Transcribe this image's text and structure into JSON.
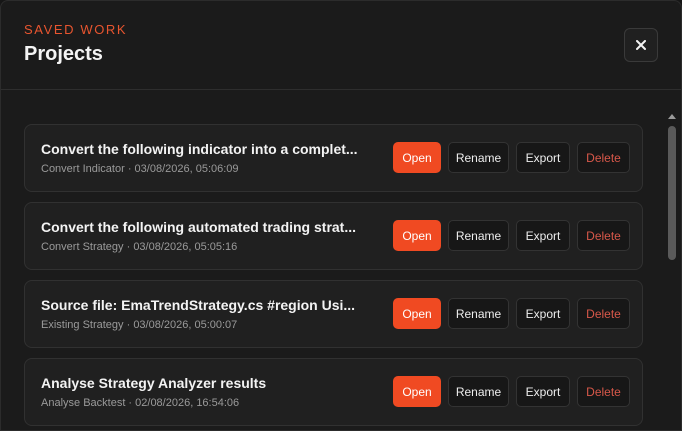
{
  "header": {
    "eyebrow": "SAVED WORK",
    "title": "Projects",
    "close_icon": "close-icon"
  },
  "buttons": {
    "open": "Open",
    "rename": "Rename",
    "export": "Export",
    "delete": "Delete"
  },
  "projects": [
    {
      "title": "Convert the following indicator into a complet...",
      "meta": "Convert Indicator · 03/08/2026, 05:06:09"
    },
    {
      "title": "Convert the following automated trading strat...",
      "meta": "Convert Strategy · 03/08/2026, 05:05:16"
    },
    {
      "title": "Source file: EmaTrendStrategy.cs #region Usi...",
      "meta": "Existing Strategy · 03/08/2026, 05:00:07"
    },
    {
      "title": "Analyse Strategy Analyzer results",
      "meta": "Analyse Backtest · 02/08/2026, 16:54:06"
    }
  ],
  "colors": {
    "accent": "#f04a22",
    "delete_text": "#d8584a",
    "background": "#1b1b1b"
  }
}
